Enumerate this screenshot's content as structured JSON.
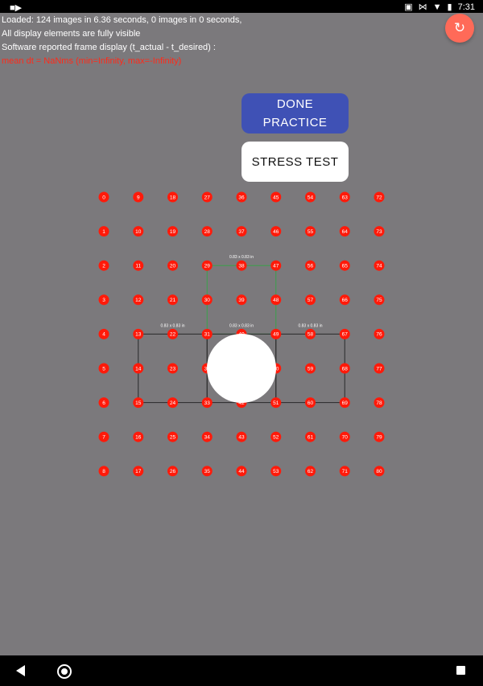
{
  "status_bar": {
    "time": "7:31",
    "icons": [
      "camera-icon",
      "cast-icon",
      "bluetooth-icon",
      "wifi-icon",
      "battery-icon"
    ]
  },
  "info": {
    "line1": "Loaded: 124 images in 6.36 seconds, 0 images in 0 seconds,",
    "line2": "All display elements are fully visible",
    "line3": "Software reported frame display (t_actual - t_desired) :",
    "line4": "mean dt = NaNms (min=Infinity, max=-Infinity)"
  },
  "buttons": {
    "refresh_icon": "refresh-icon",
    "done_line1": "DONE",
    "done_line2": "PRACTICE",
    "stress": "STRESS TEST"
  },
  "grid": {
    "columns": 9,
    "rows": 9,
    "dot_labels": [
      "0",
      "9",
      "18",
      "27",
      "36",
      "45",
      "54",
      "63",
      "72",
      "1",
      "10",
      "19",
      "28",
      "37",
      "46",
      "55",
      "64",
      "73",
      "2",
      "11",
      "20",
      "29",
      "38",
      "47",
      "56",
      "65",
      "74",
      "3",
      "12",
      "21",
      "30",
      "39",
      "48",
      "57",
      "66",
      "75",
      "4",
      "13",
      "22",
      "31",
      "40",
      "49",
      "58",
      "67",
      "76",
      "5",
      "14",
      "23",
      "32",
      "41",
      "50",
      "59",
      "68",
      "77",
      "6",
      "15",
      "24",
      "33",
      "42",
      "51",
      "60",
      "69",
      "78",
      "7",
      "16",
      "25",
      "34",
      "43",
      "52",
      "61",
      "70",
      "79",
      "8",
      "17",
      "26",
      "35",
      "44",
      "53",
      "62",
      "71",
      "80"
    ],
    "size_label": "0.83 x 0.83 in",
    "dot_color": "#ff1a0a",
    "accent_green": "#3aa14a"
  },
  "nav_bar": {
    "back_icon": "back-icon",
    "home_icon": "home-icon",
    "recents_icon": "recents-icon"
  }
}
